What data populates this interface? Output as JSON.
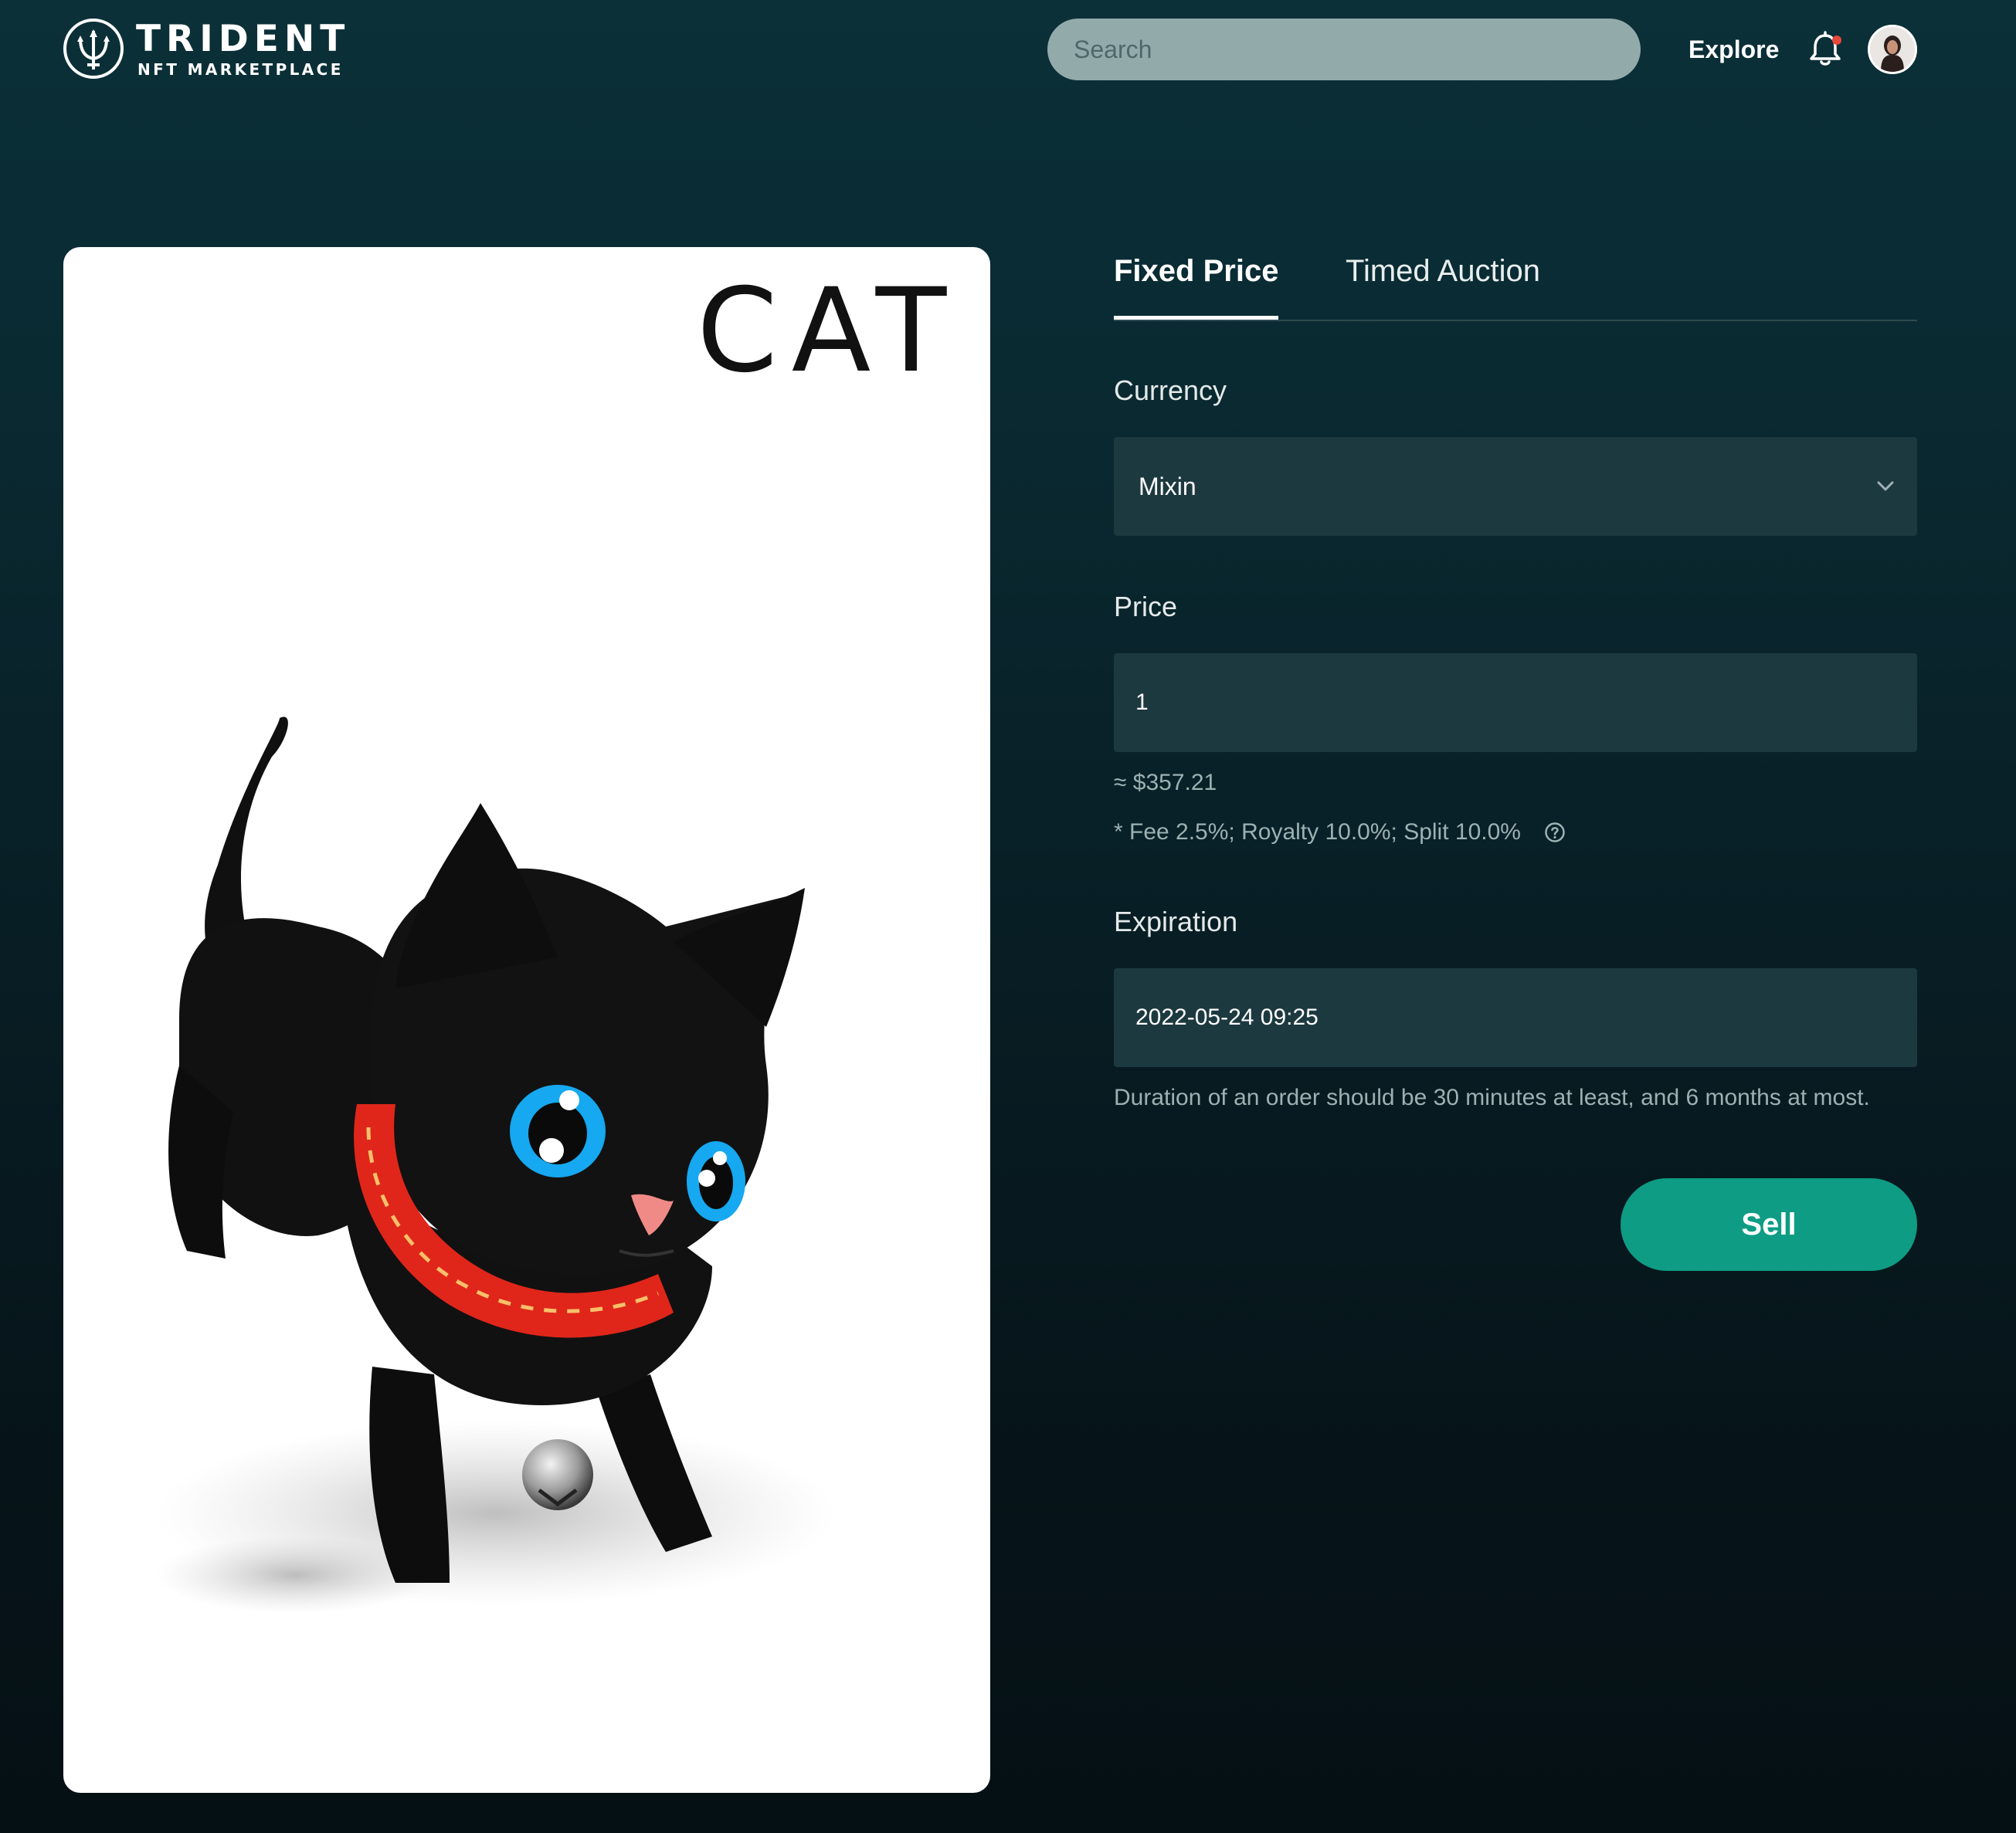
{
  "header": {
    "brand": "TRIDENT",
    "brand_subtitle": "NFT MARKETPLACE",
    "search_placeholder": "Search",
    "explore_label": "Explore",
    "notification_dot_color": "#e8473b",
    "icons": [
      "trident-logo-icon",
      "bell-icon",
      "avatar"
    ]
  },
  "artwork": {
    "caption": "CAT",
    "subject": "black kitten with red collar and bell"
  },
  "sell_form": {
    "tabs": [
      {
        "label": "Fixed Price",
        "active": true
      },
      {
        "label": "Timed Auction",
        "active": false
      }
    ],
    "currency_label": "Currency",
    "currency_value": "Mixin",
    "price_label": "Price",
    "price_value": "1",
    "usd_estimate": "≈ $357.21",
    "fee_note": "* Fee 2.5%; Royalty 10.0%; Split 10.0%",
    "expiration_label": "Expiration",
    "expiration_value": "2022-05-24 09:25",
    "duration_note": "Duration of an order should be 30 minutes at least, and 6 months at most.",
    "sell_label": "Sell",
    "accent_color": "#0e9c84"
  }
}
